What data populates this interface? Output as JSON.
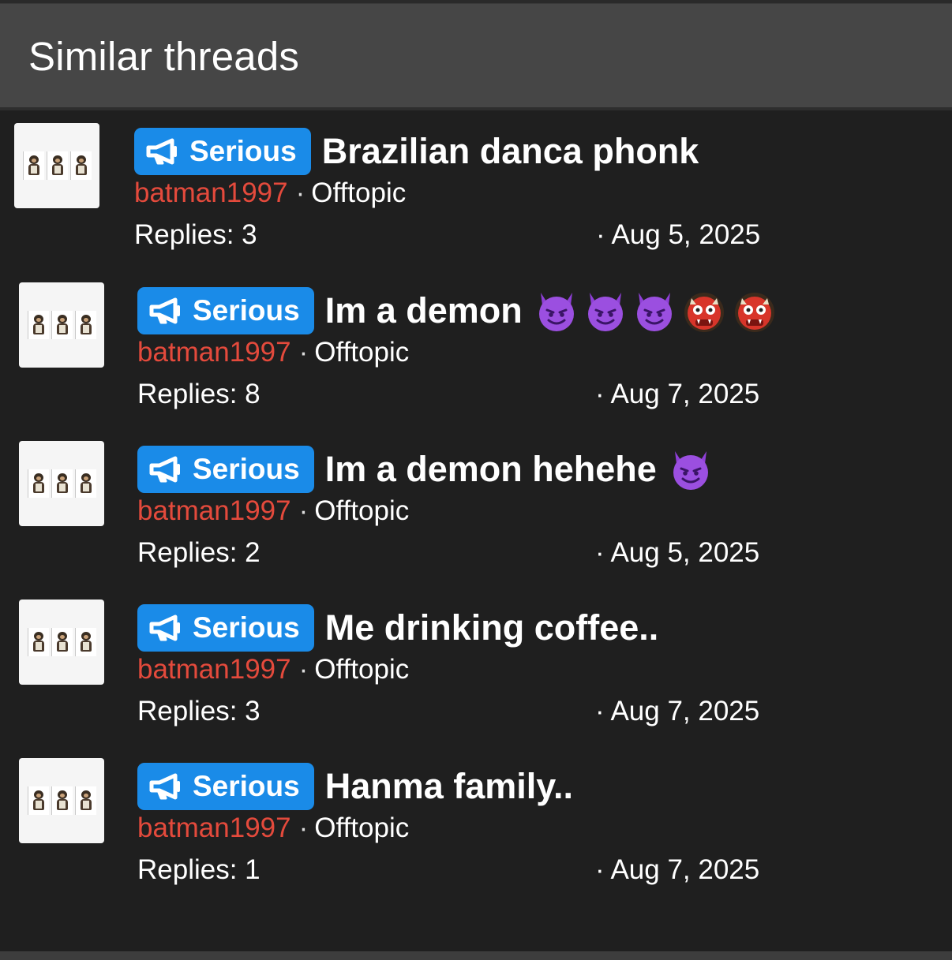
{
  "panel": {
    "title": "Similar threads"
  },
  "badge_icon": "megaphone-icon",
  "colors": {
    "badge": "#1a8be8",
    "author": "#e44a3c",
    "header_bg": "#464646",
    "panel_bg": "#1f1f1f"
  },
  "threads": [
    {
      "prefix": "Serious",
      "title": "Brazilian danca phonk",
      "emojis": [],
      "author": "batman1997",
      "separator": "·",
      "forum": "Offtopic",
      "replies": "Replies: 3",
      "date": "· Aug 5, 2025",
      "avatar": "three-monkeys-avatar"
    },
    {
      "prefix": "Serious",
      "title": "Im a demon",
      "emojis": [
        "smiling-imp-icon",
        "smiling-imp-icon",
        "smiling-imp-icon",
        "ogre-icon",
        "ogre-icon"
      ],
      "author": "batman1997",
      "separator": "·",
      "forum": "Offtopic",
      "replies": "Replies: 8",
      "date": "· Aug 7, 2025",
      "avatar": "three-monkeys-avatar"
    },
    {
      "prefix": "Serious",
      "title": "Im a demon hehehe",
      "emojis": [
        "smiling-imp-icon"
      ],
      "author": "batman1997",
      "separator": "·",
      "forum": "Offtopic",
      "replies": "Replies: 2",
      "date": "· Aug 5, 2025",
      "avatar": "three-monkeys-avatar"
    },
    {
      "prefix": "Serious",
      "title": "Me drinking coffee..",
      "emojis": [],
      "author": "batman1997",
      "separator": "·",
      "forum": "Offtopic",
      "replies": "Replies: 3",
      "date": "· Aug 7, 2025",
      "avatar": "three-monkeys-avatar"
    },
    {
      "prefix": "Serious",
      "title": "Hanma family..",
      "emojis": [],
      "author": "batman1997",
      "separator": "·",
      "forum": "Offtopic",
      "replies": "Replies: 1",
      "date": "· Aug 7, 2025",
      "avatar": "three-monkeys-avatar"
    }
  ]
}
